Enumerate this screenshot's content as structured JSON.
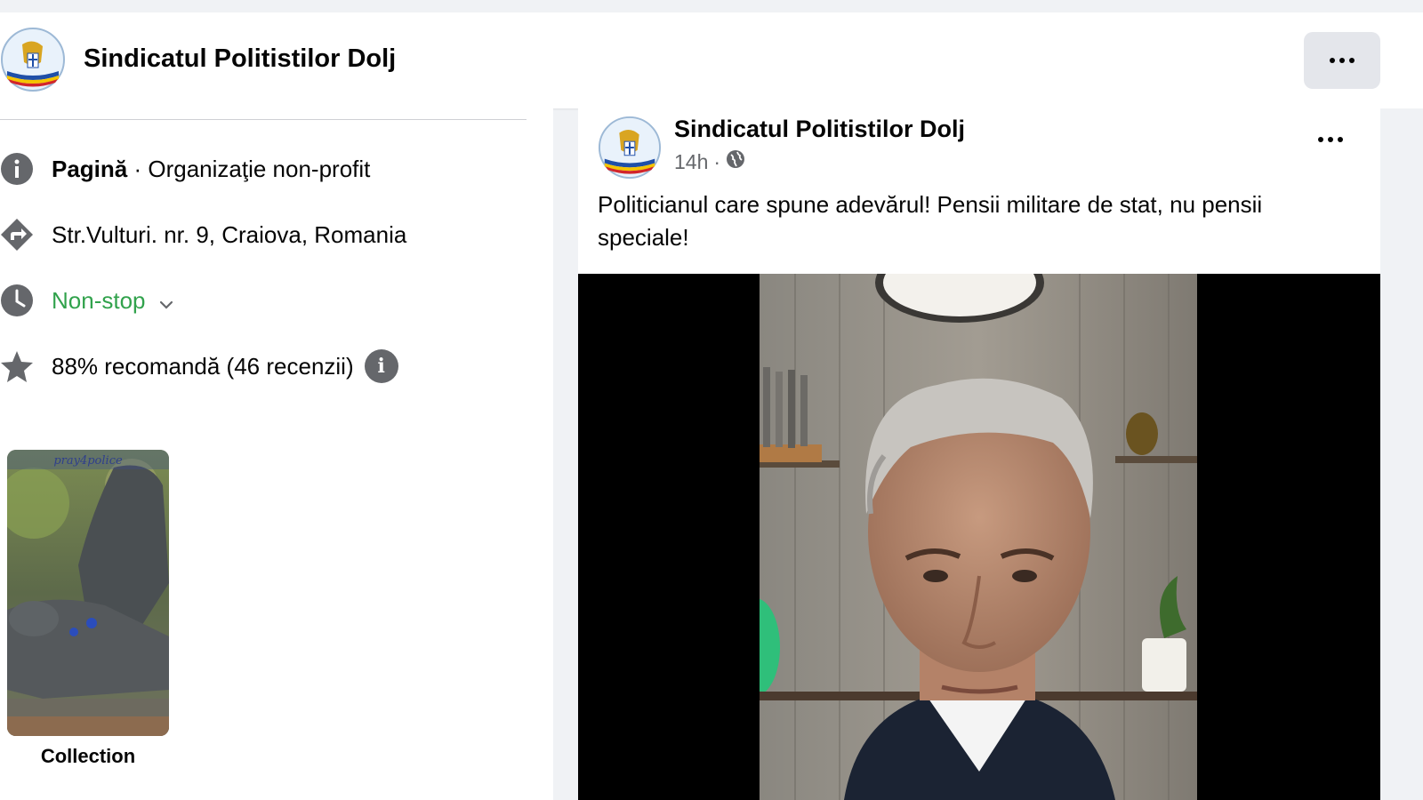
{
  "page": {
    "name": "Sindicatul Politistilor Dolj"
  },
  "about": {
    "category_prefix": "Pagină",
    "category": " · Organizaţie non-profit",
    "address": "Str.Vulturi. nr. 9, Craiova, Romania",
    "hours": "Non-stop",
    "rating": "88% recomandă (46 recenzii)"
  },
  "collection": {
    "label": "Collection",
    "thumb_caption": "pray4police"
  },
  "post": {
    "author": "Sindicatul Politistilor Dolj",
    "time": "14h",
    "separator": "·",
    "text": "Politicianul care spune adevărul! Pensii militare de stat, nu pensii speciale!"
  },
  "colors": {
    "accent_green": "#31a24c",
    "secondary_text": "#65676b",
    "button_bg": "#e4e6eb"
  },
  "icons": [
    "info-icon",
    "directions-icon",
    "clock-icon",
    "star-icon",
    "globe-icon",
    "more-dots-icon",
    "chevron-down-icon"
  ]
}
